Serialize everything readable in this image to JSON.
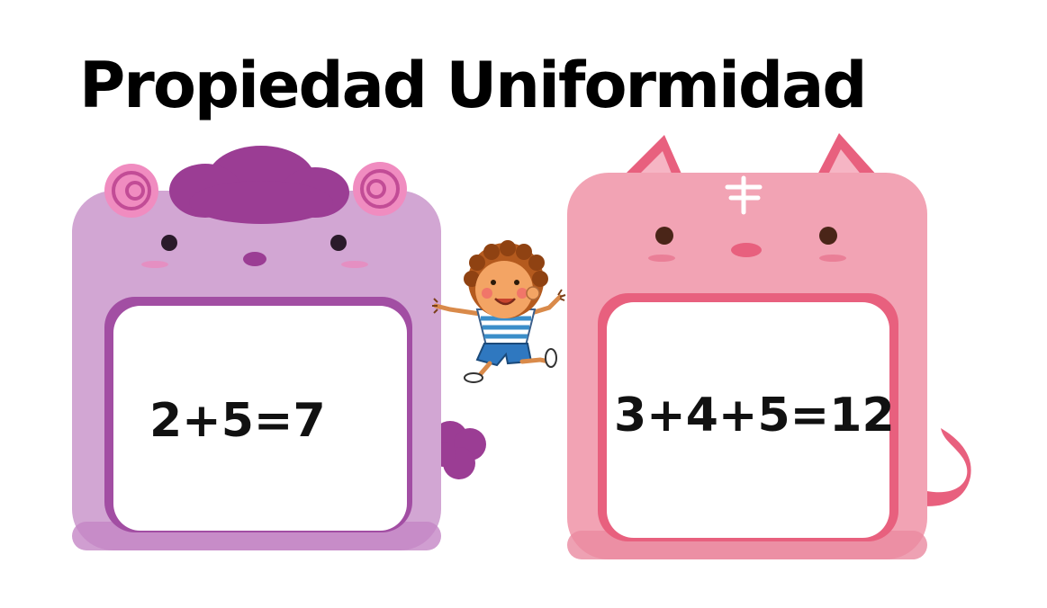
{
  "title": "Propiedad Uniformidad",
  "cards": [
    {
      "character": "sheep-monster",
      "equation": "2+5=7",
      "color": "#d4a8d4"
    },
    {
      "character": "cat",
      "equation": "3+4+5=12",
      "color": "#f2a3b4"
    }
  ],
  "colors": {
    "purple_hair": "#9b3d94",
    "pink_horn": "#f08cc0",
    "cat_pink": "#f2a3b4",
    "cat_dark": "#e8607e",
    "card_white": "#ffffff"
  }
}
